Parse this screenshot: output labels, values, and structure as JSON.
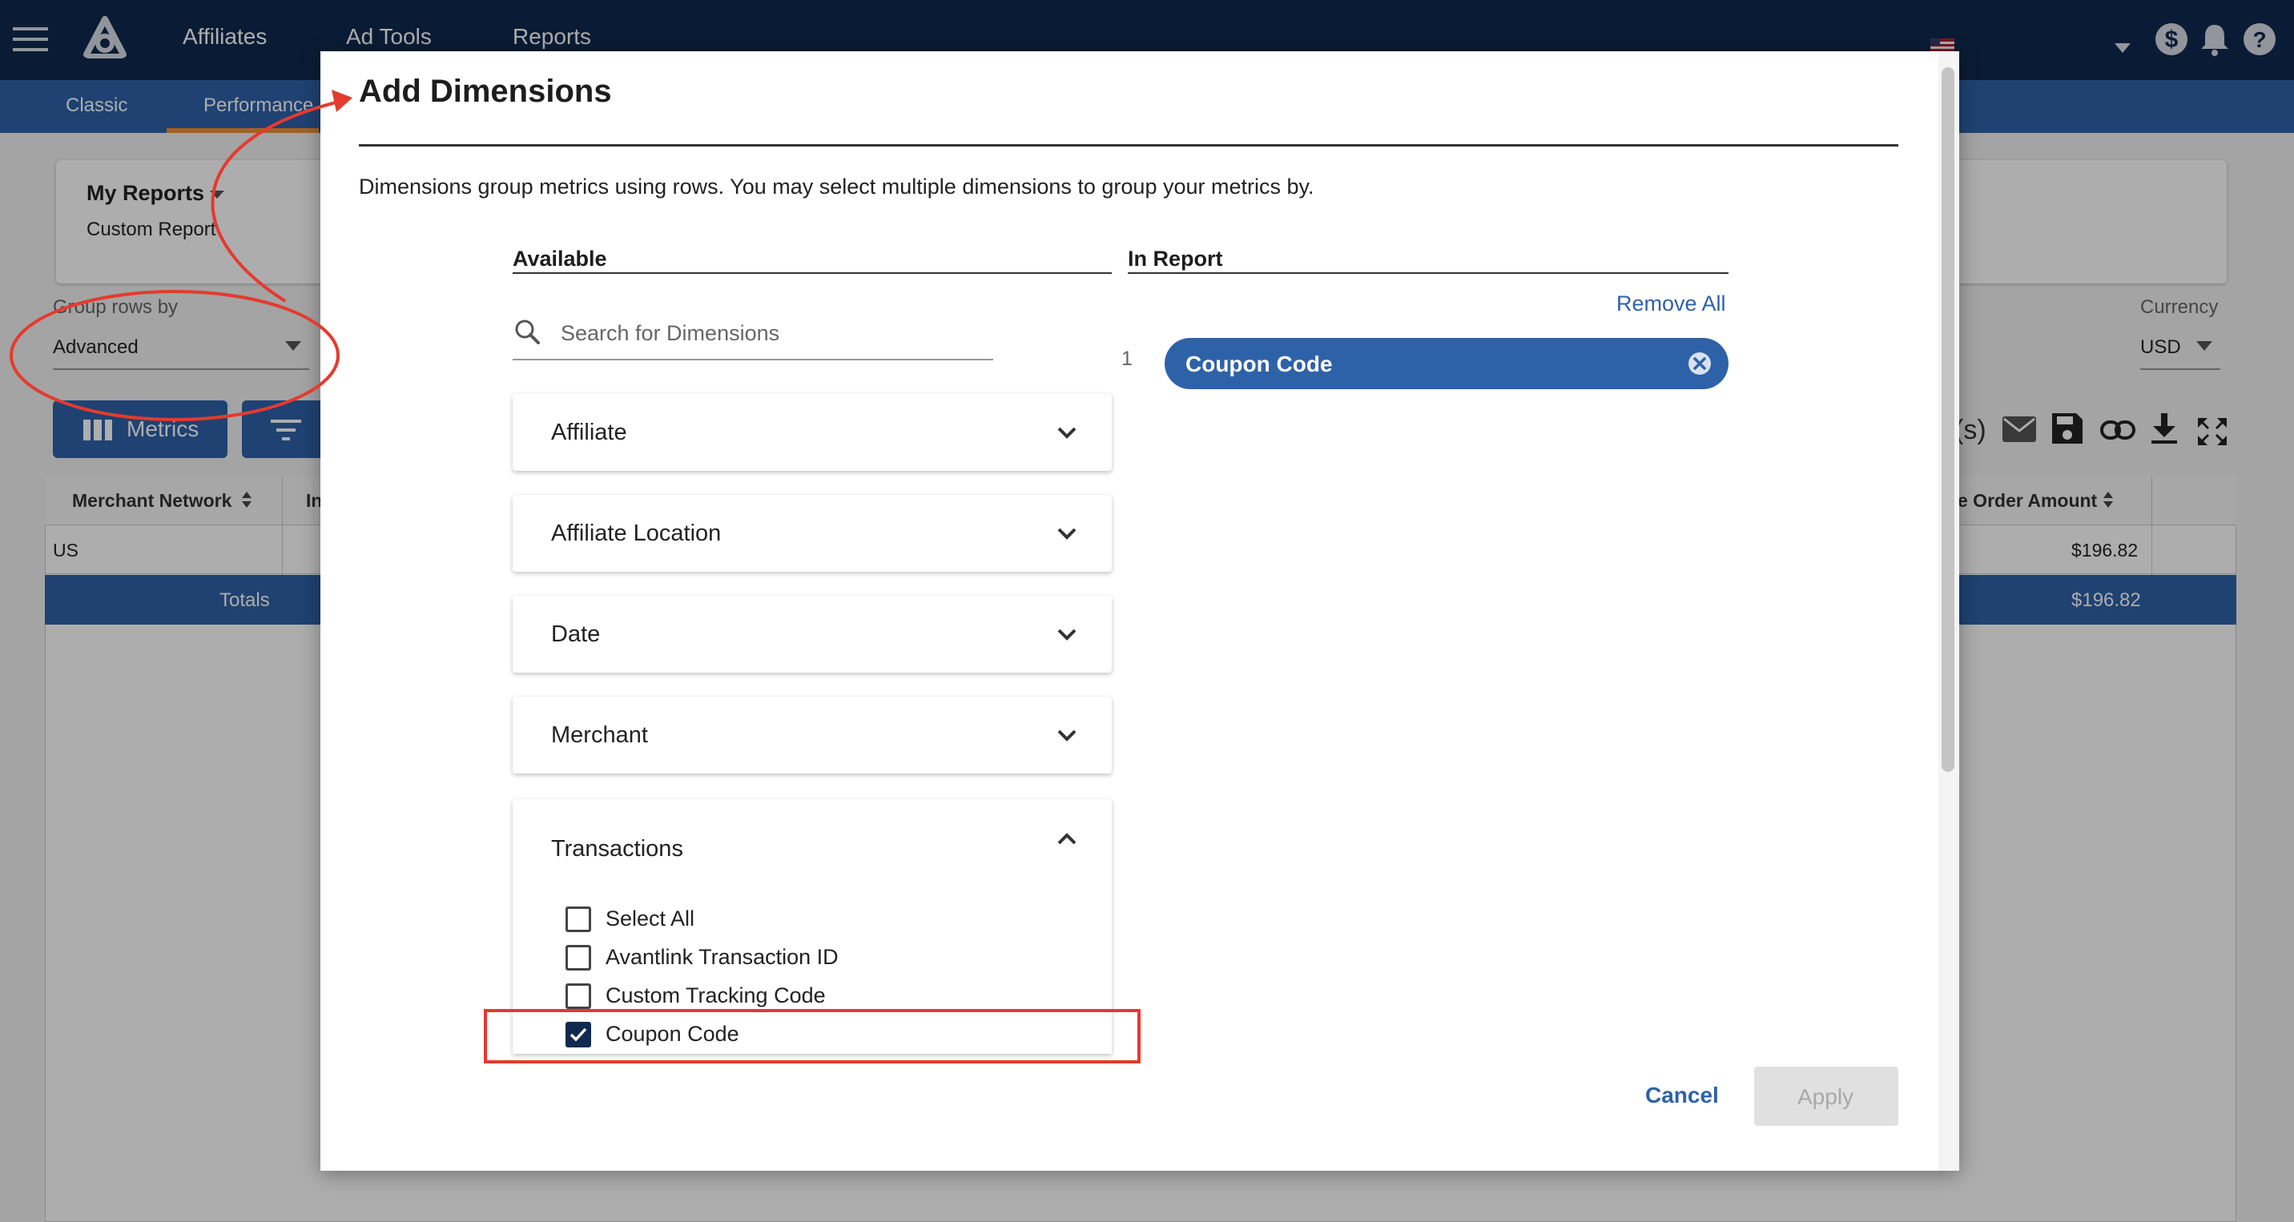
{
  "topnav": {
    "links": [
      "Affiliates",
      "Ad Tools",
      "Reports"
    ]
  },
  "subnav": {
    "tabs": [
      "Classic",
      "Performance"
    ]
  },
  "reports": {
    "title": "My Reports",
    "subtitle": "Custom Report",
    "group_rows_label": "Group rows by",
    "group_rows_value": "Advanced",
    "currency_label": "Currency",
    "currency_value": "USD",
    "metrics_button": "Metrics",
    "toolbar_partial": "(s)"
  },
  "table": {
    "headers": [
      "Merchant Network",
      "In",
      "e Order Amount"
    ],
    "row": {
      "network": "US",
      "amount": "$196.82"
    },
    "totals": {
      "label": "Totals",
      "amount": "$196.82"
    }
  },
  "modal": {
    "title": "Add Dimensions",
    "description": "Dimensions group metrics using rows. You may select multiple dimensions to group your metrics by.",
    "available_header": "Available",
    "in_report_header": "In Report",
    "search_placeholder": "Search for Dimensions",
    "categories": [
      "Affiliate",
      "Affiliate Location",
      "Date",
      "Merchant"
    ],
    "open_category": {
      "label": "Transactions",
      "options": [
        {
          "label": "Select All",
          "checked": false
        },
        {
          "label": "Avantlink Transaction ID",
          "checked": false
        },
        {
          "label": "Custom Tracking Code",
          "checked": false
        },
        {
          "label": "Coupon Code",
          "checked": true
        }
      ]
    },
    "remove_all": "Remove All",
    "selected": [
      {
        "index": "1",
        "label": "Coupon Code"
      }
    ],
    "cancel": "Cancel",
    "apply": "Apply"
  },
  "colors": {
    "nav": "#0f2a4e",
    "primary": "#2e62a8",
    "accent": "#f3902f",
    "annotation": "#e53a2e"
  }
}
